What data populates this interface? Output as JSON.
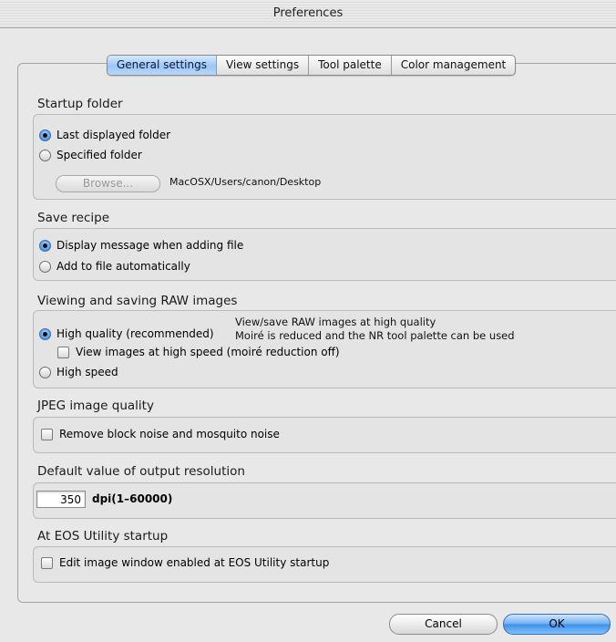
{
  "window": {
    "title": "Preferences"
  },
  "tabs": [
    {
      "label": "General settings",
      "active": true
    },
    {
      "label": "View settings",
      "active": false
    },
    {
      "label": "Tool palette",
      "active": false
    },
    {
      "label": "Color management",
      "active": false
    }
  ],
  "startup_folder": {
    "title": "Startup folder",
    "last_displayed": "Last displayed folder",
    "specified": "Specified folder",
    "browse_label": "Browse...",
    "path": "MacOSX/Users/canon/Desktop",
    "selected": "last_displayed"
  },
  "save_recipe": {
    "title": "Save recipe",
    "display_message": "Display message when adding file",
    "add_auto": "Add to file automatically",
    "selected": "display_message"
  },
  "raw": {
    "title": "Viewing and saving RAW images",
    "high_quality": "High quality (recommended)",
    "desc_line1": "View/save RAW images at high quality",
    "desc_line2": "Moiré is reduced and the NR tool palette can be used",
    "high_speed_view": "View images at high speed (moiré reduction off)",
    "high_speed": "High speed",
    "selected": "high_quality",
    "high_speed_view_checked": false
  },
  "jpeg": {
    "title": "JPEG image quality",
    "remove_noise": "Remove block noise and mosquito noise",
    "checked": false
  },
  "resolution": {
    "title": "Default value of output resolution",
    "value": "350",
    "unit": "dpi(1–60000)"
  },
  "eos": {
    "title": "At EOS Utility startup",
    "edit_window": "Edit image window enabled at EOS Utility startup",
    "checked": false
  },
  "buttons": {
    "cancel": "Cancel",
    "ok": "OK"
  }
}
